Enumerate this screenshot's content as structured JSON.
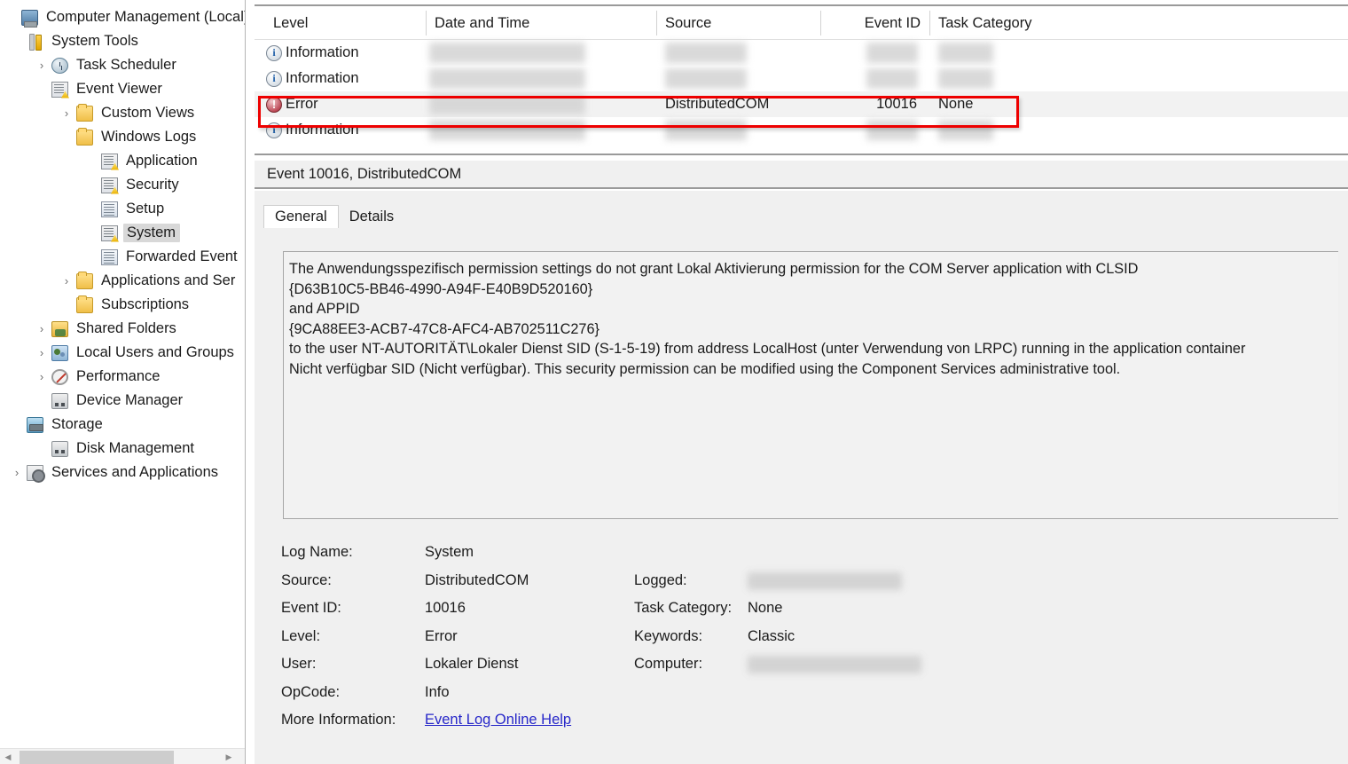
{
  "tree": {
    "items": [
      {
        "label": "Computer Management (Local)",
        "twisty": "",
        "icon": "computer-icon",
        "indent": 0,
        "selected": false
      },
      {
        "label": "System Tools",
        "twisty": "ⱟ",
        "icon": "tools-icon",
        "indent": 1,
        "selected": false
      },
      {
        "label": "Task Scheduler",
        "twisty": "›",
        "icon": "clock-icon",
        "indent": 2,
        "selected": false
      },
      {
        "label": "Event Viewer",
        "twisty": "ⱟ",
        "icon": "event-log-icon",
        "indent": 2,
        "selected": false
      },
      {
        "label": "Custom Views",
        "twisty": "›",
        "icon": "folder-filter-icon",
        "indent": 3,
        "selected": false
      },
      {
        "label": "Windows Logs",
        "twisty": "ⱟ",
        "icon": "folder-windows-icon",
        "indent": 3,
        "selected": false
      },
      {
        "label": "Application",
        "twisty": "",
        "icon": "event-log-icon",
        "indent": 4,
        "selected": false
      },
      {
        "label": "Security",
        "twisty": "",
        "icon": "event-log-icon",
        "indent": 4,
        "selected": false
      },
      {
        "label": "Setup",
        "twisty": "",
        "icon": "log-icon",
        "indent": 4,
        "selected": false
      },
      {
        "label": "System",
        "twisty": "",
        "icon": "event-log-icon",
        "indent": 4,
        "selected": true
      },
      {
        "label": "Forwarded Event",
        "twisty": "",
        "icon": "log-icon",
        "indent": 4,
        "selected": false
      },
      {
        "label": "Applications and Ser",
        "twisty": "›",
        "icon": "folder-icon",
        "indent": 3,
        "selected": false
      },
      {
        "label": "Subscriptions",
        "twisty": "",
        "icon": "folder-subscriptions-icon",
        "indent": 3,
        "selected": false
      },
      {
        "label": "Shared Folders",
        "twisty": "›",
        "icon": "shared-folders-icon",
        "indent": 2,
        "selected": false
      },
      {
        "label": "Local Users and Groups",
        "twisty": "›",
        "icon": "users-icon",
        "indent": 2,
        "selected": false
      },
      {
        "label": "Performance",
        "twisty": "›",
        "icon": "performance-icon",
        "indent": 2,
        "selected": false
      },
      {
        "label": "Device Manager",
        "twisty": "",
        "icon": "device-manager-icon",
        "indent": 2,
        "selected": false
      },
      {
        "label": "Storage",
        "twisty": "ⱟ",
        "icon": "storage-icon",
        "indent": 1,
        "selected": false
      },
      {
        "label": "Disk Management",
        "twisty": "",
        "icon": "disk-management-icon",
        "indent": 2,
        "selected": false
      },
      {
        "label": "Services and Applications",
        "twisty": "›",
        "icon": "services-icon",
        "indent": 1,
        "selected": false
      }
    ]
  },
  "event_list": {
    "columns": [
      "Level",
      "Date and Time",
      "Source",
      "Event ID",
      "Task Category"
    ],
    "rows": [
      {
        "level": "Information",
        "level_icon": "information-icon",
        "date": "",
        "source": "",
        "event_id": "",
        "task_category": "",
        "selected": false,
        "redacted": true
      },
      {
        "level": "Information",
        "level_icon": "information-icon",
        "date": "",
        "source": "",
        "event_id": "",
        "task_category": "",
        "selected": false,
        "redacted": true
      },
      {
        "level": "Error",
        "level_icon": "error-icon",
        "date": "",
        "source": "DistributedCOM",
        "event_id": "10016",
        "task_category": "None",
        "selected": true,
        "redacted": true
      },
      {
        "level": "Information",
        "level_icon": "information-icon",
        "date": "",
        "source": "",
        "event_id": "",
        "task_category": "",
        "selected": false,
        "redacted": true
      }
    ]
  },
  "detail": {
    "title": "Event 10016, DistributedCOM",
    "tabs": [
      {
        "label": "General",
        "active": true
      },
      {
        "label": "Details",
        "active": false
      }
    ],
    "description_lines": [
      "The Anwendungsspezifisch permission settings do not grant Lokal Aktivierung permission for the COM Server application with CLSID",
      "{D63B10C5-BB46-4990-A94F-E40B9D520160}",
      " and APPID",
      "{9CA88EE3-ACB7-47C8-AFC4-AB702511C276}",
      " to the user NT-AUTORITÄT\\Lokaler Dienst SID (S-1-5-19) from address LocalHost (unter Verwendung von LRPC) running in the application container",
      "Nicht verfügbar SID (Nicht verfügbar). This security permission can be modified using the Component Services administrative tool."
    ],
    "fields_left": [
      {
        "label": "Log Name:",
        "value": "System",
        "redacted": false,
        "link": false
      },
      {
        "label": "Source:",
        "value": "DistributedCOM",
        "redacted": false,
        "link": false
      },
      {
        "label": "Event ID:",
        "value": "10016",
        "redacted": false,
        "link": false
      },
      {
        "label": "Level:",
        "value": "Error",
        "redacted": false,
        "link": false
      },
      {
        "label": "User:",
        "value": "Lokaler Dienst",
        "redacted": false,
        "link": false
      },
      {
        "label": "OpCode:",
        "value": "Info",
        "redacted": false,
        "link": false
      },
      {
        "label": "More Information:",
        "value": "Event Log Online Help",
        "redacted": false,
        "link": true
      }
    ],
    "fields_right": [
      {
        "label": "Logged:",
        "value": "",
        "redacted": true,
        "link": false
      },
      {
        "label": "Task Category:",
        "value": "None",
        "redacted": false,
        "link": false
      },
      {
        "label": "Keywords:",
        "value": "Classic",
        "redacted": false,
        "link": false
      },
      {
        "label": "Computer:",
        "value": "",
        "redacted": true,
        "link": false
      }
    ]
  },
  "colors": {
    "highlight_box": "#ee0000",
    "link": "#2727c9",
    "error_icon": "#a8192a",
    "info_icon": "#1f5fa8",
    "pane_background": "#f0f0f0",
    "selection": "#d8d8d8"
  }
}
